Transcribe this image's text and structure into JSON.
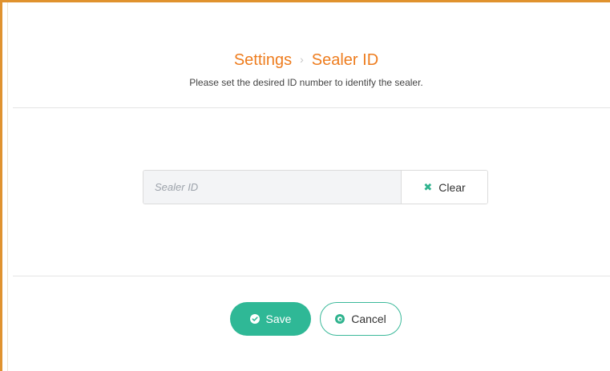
{
  "header": {
    "breadcrumb": {
      "parent": "Settings",
      "separator": "›",
      "current": "Sealer ID"
    },
    "subtitle": "Please set the desired ID number to identify the sealer."
  },
  "form": {
    "sealer_id": {
      "value": "",
      "placeholder": "Sealer ID"
    },
    "clear_label": "Clear"
  },
  "actions": {
    "save_label": "Save",
    "cancel_label": "Cancel"
  },
  "colors": {
    "accent_orange": "#ee7d1f",
    "accent_green": "#2fb896",
    "frame_border": "#e0922e"
  },
  "icons": {
    "clear": "x-icon",
    "save": "check-circle-icon",
    "cancel": "circle-dot-icon"
  }
}
